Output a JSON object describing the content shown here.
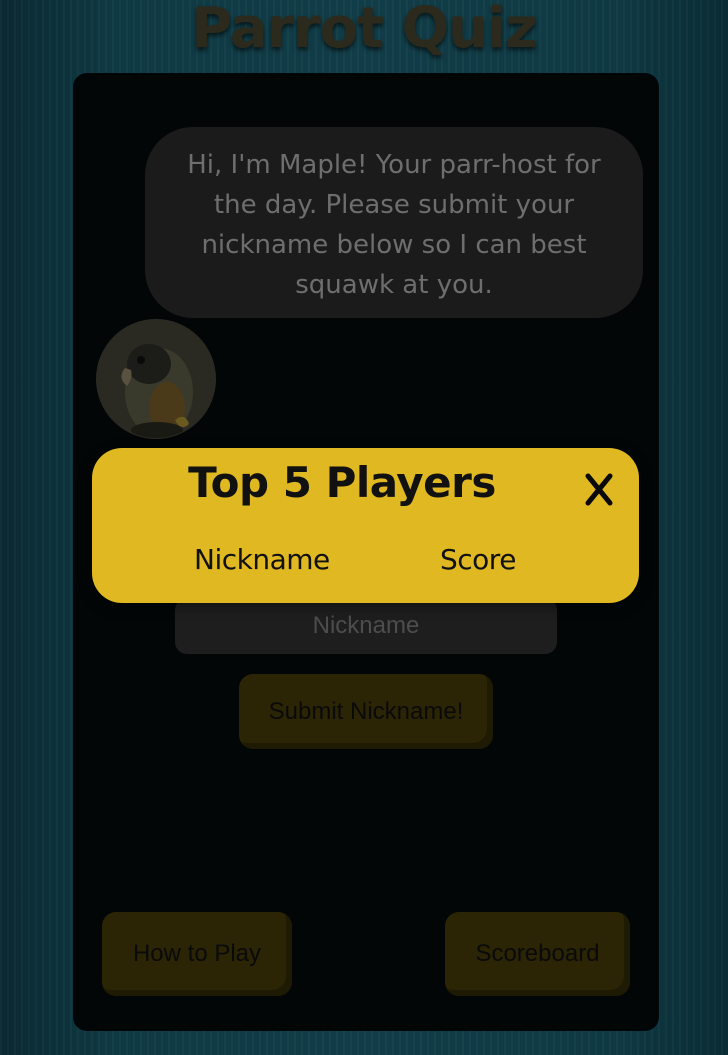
{
  "app": {
    "title": "Parrot Quiz"
  },
  "host": {
    "greeting": "Hi, I'm Maple! Your parr-host for the day. Please submit your nickname below so I can best squawk at you."
  },
  "form": {
    "nickname_placeholder": "Nickname",
    "submit_label": "Submit Nickname!"
  },
  "footer": {
    "how_to_play_label": "How to Play",
    "scoreboard_label": "Scoreboard"
  },
  "scoreboard_modal": {
    "title": "Top 5 Players",
    "close_icon": "close-icon",
    "columns": [
      "Nickname",
      "Score"
    ],
    "rows": []
  },
  "colors": {
    "accent": "#e0b821",
    "background": "#0f3a44",
    "card": "#020607"
  }
}
